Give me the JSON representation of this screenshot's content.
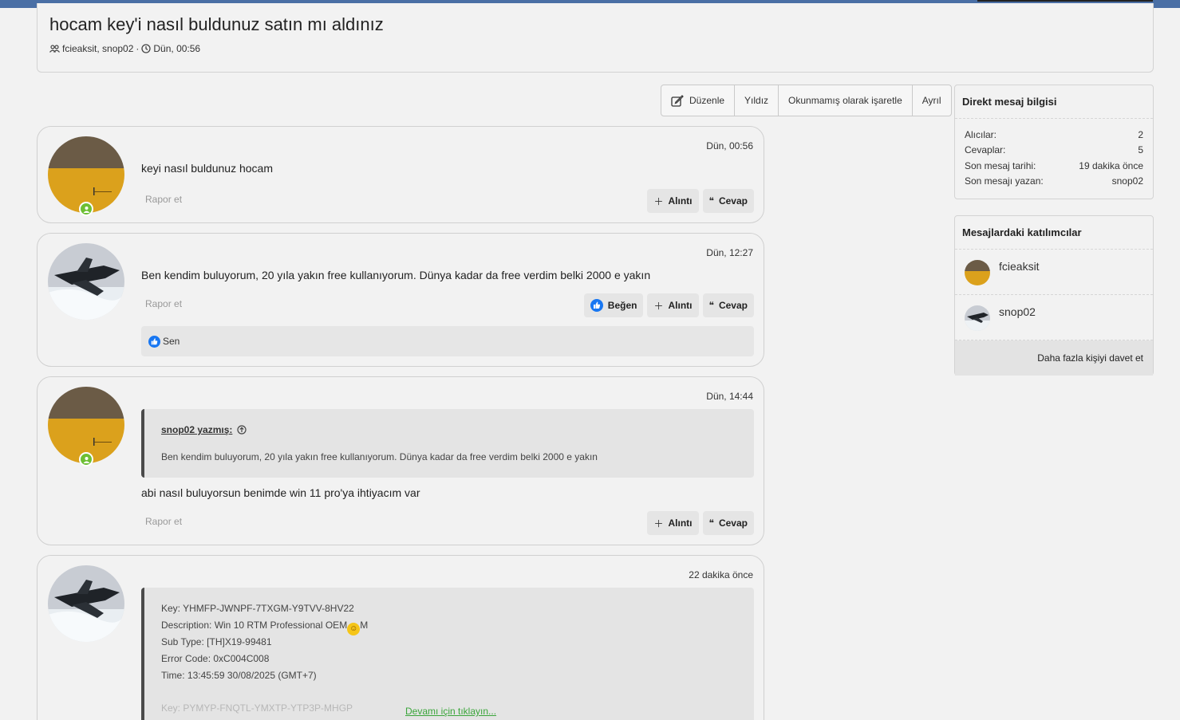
{
  "thread": {
    "title": "hocam key'i nasıl buldunuz satın mı aldınız",
    "participants": "fcieaksit, snop02",
    "separator": "·",
    "date": "Dün, 00:56"
  },
  "toolbar": {
    "edit": "Düzenle",
    "star": "Yıldız",
    "mark_unread": "Okunmamış olarak işaretle",
    "leave": "Ayrıl"
  },
  "labels": {
    "report": "Rapor et",
    "quote": "Alıntı",
    "reply": "Cevap",
    "like": "Beğen"
  },
  "posts": [
    {
      "author": "fcieaksit",
      "date": "Dün, 00:56",
      "text": "keyi nasıl buldunuz hocam"
    },
    {
      "author": "snop02",
      "date": "Dün, 12:27",
      "text": "Ben kendim buluyorum, 20 yıla yakın free kullanıyorum. Dünya kadar da free verdim belki 2000 e yakın",
      "reaction": "Sen"
    },
    {
      "author": "fcieaksit",
      "date": "Dün, 14:44",
      "quote_author": "snop02 yazmış:",
      "quote_text": "Ben kendim buluyorum, 20 yıla yakın free kullanıyorum. Dünya kadar da free verdim belki 2000 e yakın",
      "text": "abi nasıl buluyorsun benimde win 11 pro'ya ihtiyacım var"
    },
    {
      "author": "snop02",
      "date": "22 dakika önce",
      "lines": [
        "Key: YHMFP-JWNPF-7TXGM-Y9TVV-8HV22",
        "Sub Type: [TH]X19-99481",
        "Error Code: 0xC004C008",
        "Time: 13:45:59 30/08/2025 (GMT+7)"
      ],
      "desc_prefix": "Description: Win 10 RTM Professional OEM",
      "desc_suffix": "M",
      "faded": "Key: PYMYP-FNQTL-YMXTP-YTP3P-MHGP",
      "read_more": "Devamı için tıklayın..."
    }
  ],
  "dm_info": {
    "title": "Direkt mesaj bilgisi",
    "rows": [
      {
        "label": "Alıcılar:",
        "value": "2"
      },
      {
        "label": "Cevaplar:",
        "value": "5"
      },
      {
        "label": "Son mesaj tarihi:",
        "value": "19 dakika önce"
      },
      {
        "label": "Son mesajı yazan:",
        "value": "snop02"
      }
    ]
  },
  "participants_box": {
    "title": "Mesajlardaki katılımcılar",
    "names": [
      "fcieaksit",
      "snop02"
    ],
    "invite": "Daha fazla kişiyi davet et"
  },
  "colors": {
    "link_green": "#3aa53a",
    "like_blue": "#1877f2",
    "online_green": "#6dbf34",
    "top_bar": "#4a6fa5"
  }
}
